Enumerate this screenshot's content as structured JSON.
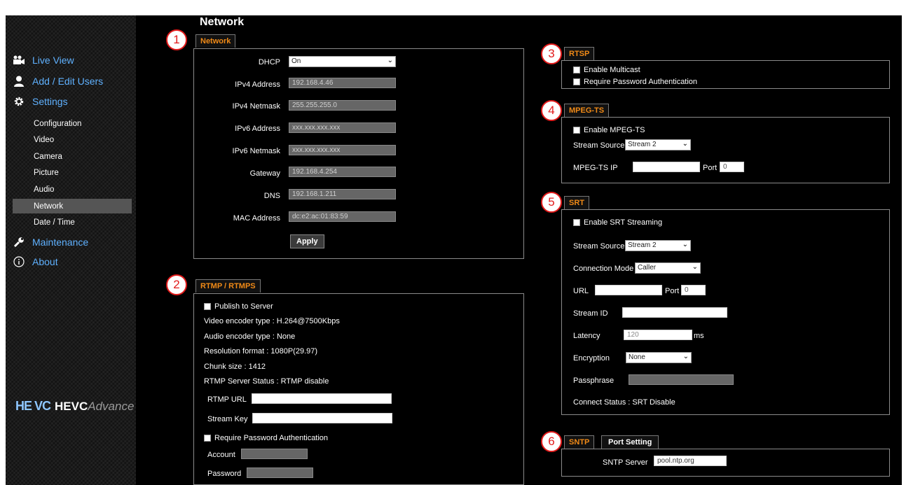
{
  "page_title": "Network",
  "sidebar": {
    "main": [
      {
        "label": "Live View",
        "icon": "camera-icon"
      },
      {
        "label": "Add / Edit Users",
        "icon": "user-icon"
      },
      {
        "label": "Settings",
        "icon": "gear-icon"
      }
    ],
    "sub": [
      "Configuration",
      "Video",
      "Camera",
      "Picture",
      "Audio",
      "Network",
      "Date / Time"
    ],
    "selected": "Network",
    "bottom": [
      {
        "label": "Maintenance",
        "icon": "wrench-icon"
      },
      {
        "label": "About",
        "icon": "info-icon"
      }
    ],
    "logo": {
      "mark": "HE VC",
      "name": "HEVC",
      "name2": "Advance"
    }
  },
  "callouts": [
    "1",
    "2",
    "3",
    "4",
    "5",
    "6"
  ],
  "network": {
    "tab": "Network",
    "fields": [
      {
        "label": "DHCP",
        "value": "On"
      },
      {
        "label": "IPv4 Address",
        "value": "192.168.4.46"
      },
      {
        "label": "IPv4 Netmask",
        "value": "255.255.255.0"
      },
      {
        "label": "IPv6 Address",
        "value": "xxx.xxx.xxx.xxx"
      },
      {
        "label": "IPv6 Netmask",
        "value": "xxx.xxx.xxx.xxx"
      },
      {
        "label": "Gateway",
        "value": "192.168.4.254"
      },
      {
        "label": "DNS",
        "value": "192.168.1.211"
      },
      {
        "label": "MAC Address",
        "value": "dc:e2:ac:01:83:59"
      }
    ],
    "apply_label": "Apply"
  },
  "rtmp": {
    "tab": "RTMP / RTMPS",
    "publish_label": "Publish to Server",
    "lines": [
      "Video encoder type : H.264@7500Kbps",
      "Audio encoder type : None",
      "Resolution format : 1080P(29.97)",
      "Chunk size : 1412",
      "RTMP Server Status : RTMP disable"
    ],
    "rtmp_url_label": "RTMP URL",
    "stream_key_label": "Stream Key",
    "require_auth_label": "Require Password Authentication",
    "account_label": "Account",
    "password_label": "Password"
  },
  "rtsp": {
    "tab": "RTSP",
    "multicast_label": "Enable Multicast",
    "auth_label": "Require Password Authentication"
  },
  "mpegts": {
    "tab": "MPEG-TS",
    "enable_label": "Enable MPEG-TS",
    "source_label": "Stream Source",
    "source_value": "Stream 2",
    "ip_label": "MPEG-TS IP",
    "port_label": "Port",
    "port_value": "0"
  },
  "srt": {
    "tab": "SRT",
    "enable_label": "Enable SRT Streaming",
    "source_label": "Stream Source",
    "source_value": "Stream 2",
    "mode_label": "Connection Mode",
    "mode_value": "Caller",
    "url_label": "URL",
    "port_label": "Port",
    "port_value": "0",
    "stream_id_label": "Stream ID",
    "latency_label": "Latency",
    "latency_value": "120",
    "latency_unit": "ms",
    "encryption_label": "Encryption",
    "encryption_value": "None",
    "passphrase_label": "Passphrase",
    "status_text": "Connect Status : SRT Disable"
  },
  "sntp": {
    "tab": "SNTP",
    "tab2": "Port Setting",
    "server_label": "SNTP Server",
    "server_value": "pool.ntp.org"
  },
  "colors": {
    "accent": "#f08a17",
    "nav_link": "#5fb1ff",
    "callout": "#e21b1b"
  }
}
